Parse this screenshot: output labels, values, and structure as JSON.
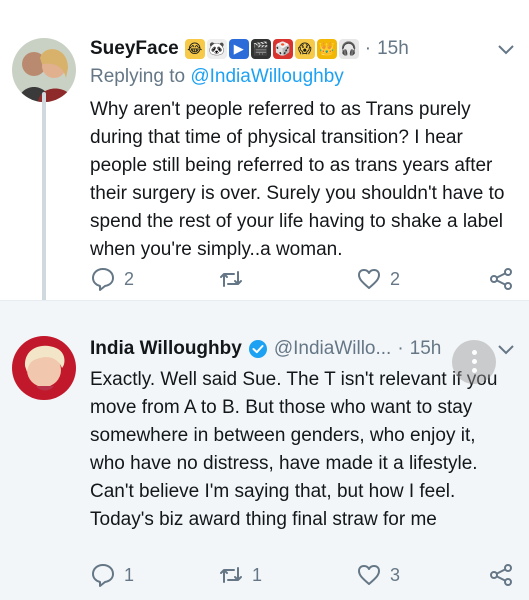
{
  "tweets": [
    {
      "name": "SueyFace",
      "emojis": [
        "😂",
        "🐼",
        "▶",
        "🎬",
        "🎲",
        "😱",
        "👑",
        "🎧"
      ],
      "time": "15h",
      "reply_prefix": "Replying to ",
      "reply_handle": "@IndiaWilloughby",
      "text": "Why aren't people referred to as Trans purely during that time of physical transition? I hear people still being referred to as trans years after their surgery is over. Surely you shouldn't have to spend the rest of your life having to shake a label when you're simply..a woman.",
      "replies": "2",
      "retweets": "",
      "likes": "2"
    },
    {
      "name": "India Willoughby",
      "handle": "@IndiaWillo...",
      "time": "15h",
      "text": "Exactly. Well said Sue. The T isn't relevant if you move from A to B. But those who want to stay somewhere in between genders, who enjoy it, who have no distress, have made it a lifestyle. Can't believe I'm saying that, but how I feel. Today's biz award thing final straw for me",
      "replies": "1",
      "retweets": "1",
      "likes": "3"
    }
  ],
  "separator": "·",
  "colors": {
    "accent": "#1da1f2",
    "muted": "#657786",
    "text": "#14171a",
    "thread_line": "#cfd9de",
    "highlight_bg": "#f3f6f8"
  },
  "icons": {
    "reply": "reply-icon",
    "retweet": "retweet-icon",
    "like": "heart-icon",
    "share": "share-icon",
    "menu": "chevron-down-icon",
    "verified": "verified-badge-icon"
  }
}
